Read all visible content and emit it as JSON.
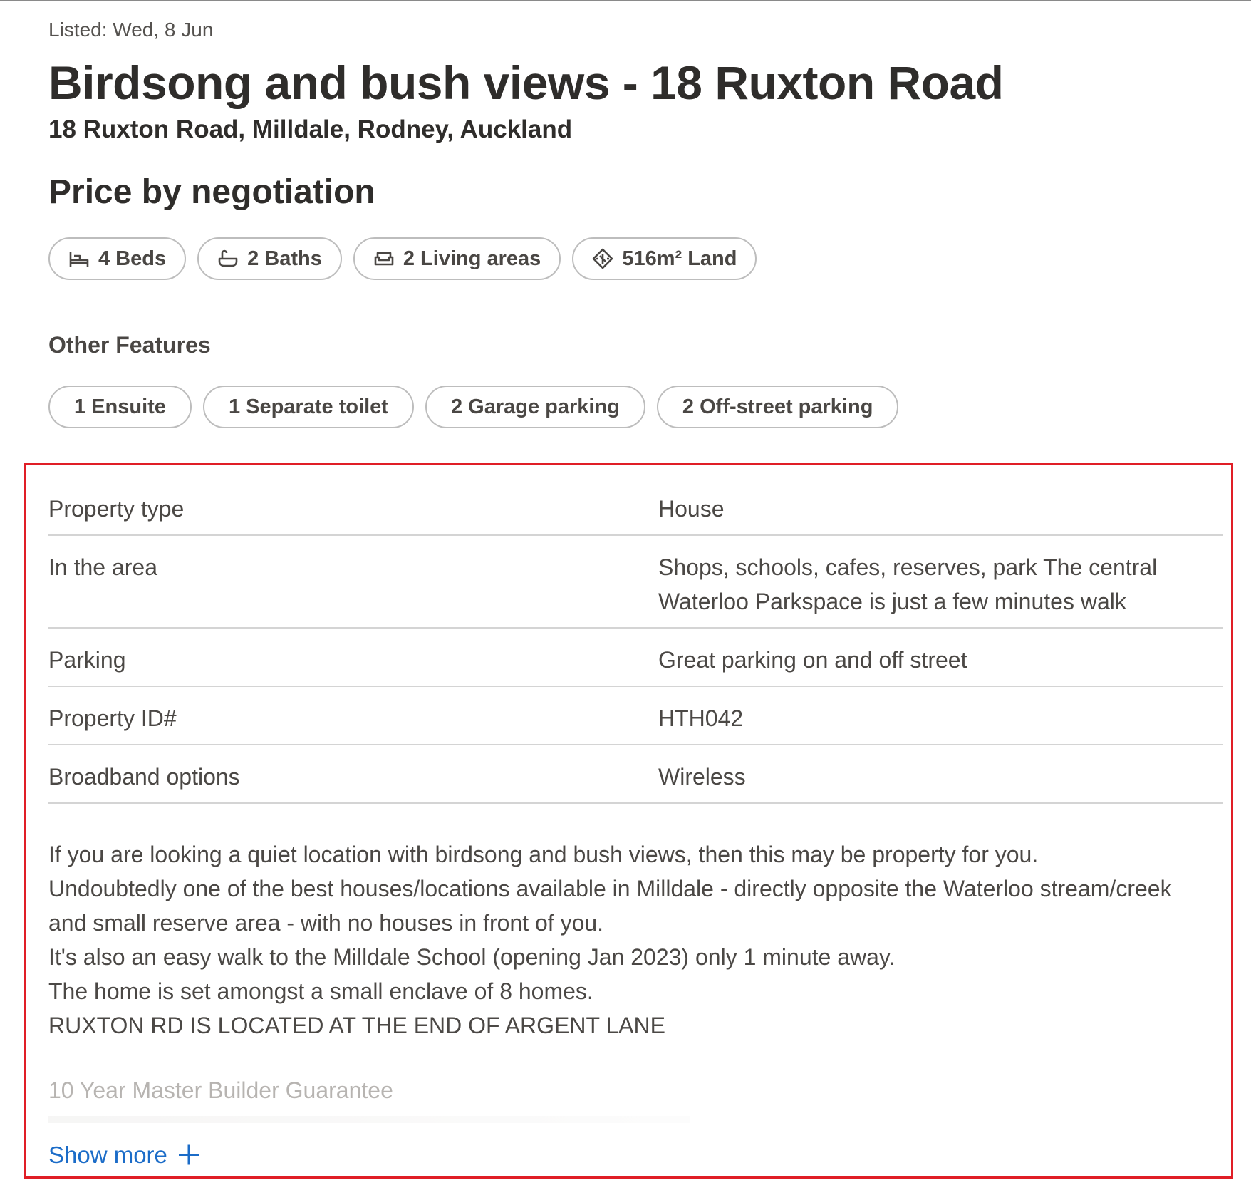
{
  "listing": {
    "listed": "Listed: Wed, 8 Jun",
    "title": "Birdsong and bush views - 18 Ruxton Road",
    "address": "18 Ruxton Road, Milldale, Rodney, Auckland",
    "price": "Price by negotiation"
  },
  "key_features": [
    {
      "icon": "bed-icon",
      "label": "4 Beds"
    },
    {
      "icon": "bath-icon",
      "label": "2 Baths"
    },
    {
      "icon": "sofa-icon",
      "label": "2 Living areas"
    },
    {
      "icon": "land-area-icon",
      "label": "516m² Land"
    }
  ],
  "other_features": {
    "heading": "Other Features",
    "items": [
      "1 Ensuite",
      "1 Separate toilet",
      "2 Garage parking",
      "2 Off-street parking"
    ]
  },
  "details": [
    {
      "label": "Property type",
      "value": "House"
    },
    {
      "label": "In the area",
      "value_lines": [
        "Shops, schools, cafes, reserves, park The central",
        "Waterloo Parkspace is just a few minutes walk"
      ]
    },
    {
      "label": "Parking",
      "value": "Great parking on and off street"
    },
    {
      "label": "Property ID#",
      "value": "HTH042"
    },
    {
      "label": "Broadband options",
      "value": "Wireless"
    }
  ],
  "description": {
    "lines": [
      "If you are looking a quiet location with birdsong and bush views, then this may be property for you.",
      "Undoubtedly one of the best houses/locations available in Milldale - directly opposite the Waterloo stream/creek",
      "and small reserve area - with no houses in front of you.",
      "It's also an easy walk to the Milldale School (opening Jan 2023) only 1 minute away.",
      "The home is set amongst a small enclave of 8 homes.",
      "RUXTON RD IS LOCATED AT THE END OF ARGENT LANE"
    ],
    "faded_line": "10 Year Master Builder Guarantee",
    "show_more": "Show more"
  },
  "colors": {
    "highlight_border": "#e01e26",
    "link": "#1b6cc8",
    "text": "#4b4845"
  }
}
